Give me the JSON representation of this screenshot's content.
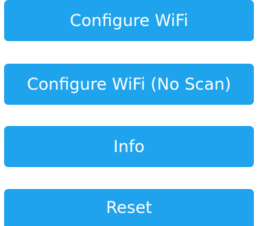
{
  "menu": {
    "buttons": [
      {
        "label": "Configure WiFi"
      },
      {
        "label": "Configure WiFi (No Scan)"
      },
      {
        "label": "Info"
      },
      {
        "label": "Reset"
      }
    ]
  },
  "colors": {
    "button_background": "#1fa3ec",
    "button_text": "#ffffff",
    "page_background": "#ffffff"
  }
}
